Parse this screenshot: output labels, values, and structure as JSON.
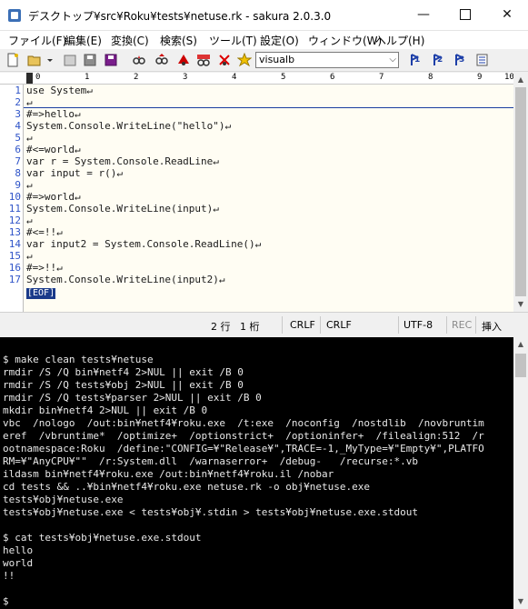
{
  "window": {
    "title": "デスクトップ¥src¥Roku¥tests¥netuse.rk - sakura 2.0.3.0",
    "minimize": "—",
    "close": "✕"
  },
  "menu": [
    "ファイル(F)",
    "編集(E)",
    "変換(C)",
    "検索(S)",
    "ツール(T)",
    "設定(O)",
    "ウィンドウ(W)",
    "ヘルプ(H)"
  ],
  "toolbar": {
    "search_value": "visualb",
    "bookmark_labels": [
      "1",
      "2",
      "3"
    ]
  },
  "ruler": {
    "ticks": [
      "0",
      "1",
      "2",
      "3",
      "4",
      "5",
      "6",
      "7",
      "8",
      "9",
      "10"
    ]
  },
  "editor": {
    "lines": [
      {
        "n": "1",
        "text": "use System↵"
      },
      {
        "n": "2",
        "text": "↵"
      },
      {
        "n": "3",
        "text": "#=>hello↵"
      },
      {
        "n": "4",
        "text": "System.Console.WriteLine(\"hello\")↵"
      },
      {
        "n": "5",
        "text": "↵"
      },
      {
        "n": "6",
        "text": "#<=world↵"
      },
      {
        "n": "7",
        "text": "var r = System.Console.ReadLine↵"
      },
      {
        "n": "8",
        "text": "var input = r()↵"
      },
      {
        "n": "9",
        "text": "↵"
      },
      {
        "n": "10",
        "text": "#=>world↵"
      },
      {
        "n": "11",
        "text": "System.Console.WriteLine(input)↵"
      },
      {
        "n": "12",
        "text": "↵"
      },
      {
        "n": "13",
        "text": "#<=!!↵"
      },
      {
        "n": "14",
        "text": "var input2 = System.Console.ReadLine()↵"
      },
      {
        "n": "15",
        "text": "↵"
      },
      {
        "n": "16",
        "text": "#=>!!↵"
      },
      {
        "n": "17",
        "text": "System.Console.WriteLine(input2)↵"
      }
    ],
    "eof": "[EOF]"
  },
  "status": {
    "row": "2 行",
    "col": "1 桁",
    "eol1": "CRLF",
    "eol2": "CRLF",
    "encoding": "UTF-8",
    "rec": "REC",
    "mode": "挿入"
  },
  "terminal": {
    "lines": [
      "",
      "$ make clean tests¥netuse",
      "rmdir /S /Q bin¥netf4 2>NUL || exit /B 0",
      "rmdir /S /Q tests¥obj 2>NUL || exit /B 0",
      "rmdir /S /Q tests¥parser 2>NUL || exit /B 0",
      "mkdir bin¥netf4 2>NUL || exit /B 0",
      "vbc  /nologo  /out:bin¥netf4¥roku.exe  /t:exe  /noconfig  /nostdlib  /novbruntim",
      "eref  /vbruntime*  /optimize+  /optionstrict+  /optioninfer+  /filealign:512  /r",
      "ootnamespace:Roku  /define:\"CONFIG=¥\"Release¥\",TRACE=-1,_MyType=¥\"Empty¥\",PLATFO",
      "RM=¥\"AnyCPU¥\"\"  /r:System.dll  /warnaserror+  /debug-   /recurse:*.vb",
      "ildasm bin¥netf4¥roku.exe /out:bin¥netf4¥roku.il /nobar",
      "cd tests && ..¥bin¥netf4¥roku.exe netuse.rk -o obj¥netuse.exe",
      "tests¥obj¥netuse.exe",
      "tests¥obj¥netuse.exe < tests¥obj¥.stdin > tests¥obj¥netuse.exe.stdout",
      "",
      "$ cat tests¥obj¥netuse.exe.stdout",
      "hello",
      "world",
      "!!",
      "",
      "",
      "$"
    ]
  },
  "colors": {
    "line_number": "#2f54c8",
    "editor_bg": "#fffdf3",
    "eof_bg": "#1a3a8a",
    "terminal_bg": "#000000",
    "terminal_fg": "#e8e8e8"
  }
}
